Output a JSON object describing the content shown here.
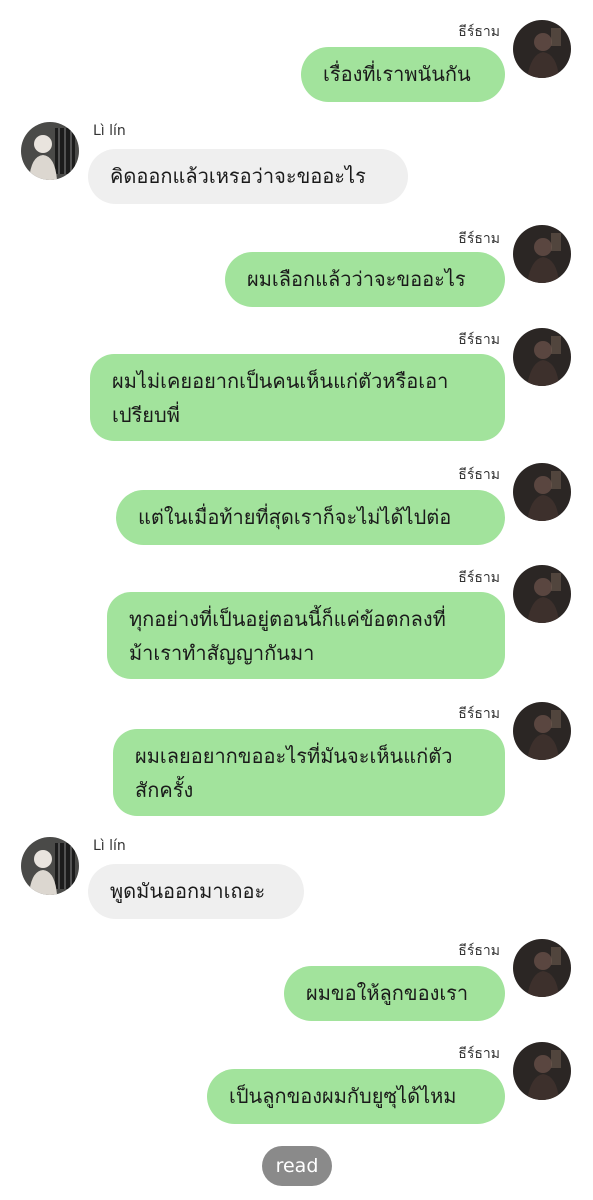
{
  "chat": {
    "users": {
      "me": {
        "name": "ธีร์ธาม"
      },
      "other": {
        "name": "Lì lín"
      }
    },
    "messages": [
      {
        "lines": [
          "เรื่องที่เราพนันกัน"
        ]
      },
      {
        "lines": [
          "คิดออกแล้วเหรอว่าจะขออะไร"
        ]
      },
      {
        "lines": [
          "ผมเลือกแล้วว่าจะขออะไร"
        ]
      },
      {
        "lines": [
          "ผมไม่เคยอยากเป็นคนเห็นแก่ตัวหรือเอา",
          "เปรียบพี่"
        ]
      },
      {
        "lines": [
          "แต่ในเมื่อท้ายที่สุดเราก็จะไม่ได้ไปต่อ"
        ]
      },
      {
        "lines": [
          "ทุกอย่างที่เป็นอยู่ตอนนี้ก็แค่ข้อตกลงที่",
          "ม้าเราทำสัญญากันมา"
        ]
      },
      {
        "lines": [
          "ผมเลยอยากขออะไรที่มันจะเห็นแก่ตัว",
          "สักครั้ง"
        ]
      },
      {
        "lines": [
          "พูดมันออกมาเถอะ"
        ]
      },
      {
        "lines": [
          "ผมขอให้ลูกของเรา"
        ]
      },
      {
        "lines": [
          "เป็นลูกของผมกับยูซุได้ไหม"
        ]
      }
    ],
    "read_label": "read",
    "colors": {
      "outgoing_bubble": "#a2e39c",
      "incoming_bubble": "#efefef",
      "read_pill": "#8a8a8a"
    },
    "icons": {
      "avatar_me": "avatar-dark-photo",
      "avatar_other": "avatar-person-photo"
    }
  }
}
